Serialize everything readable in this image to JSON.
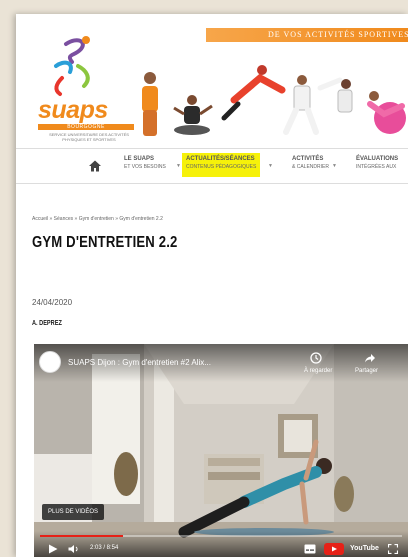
{
  "header": {
    "banner_text": "DE VOS ACTIVITÉS SPORTIVES",
    "logo_word": "suaps",
    "logo_sub": "BOURGOGNE",
    "logo_tagline": "SERVICE UNIVERSITAIRE DES ACTIVITÉS PHYSIQUES ET SPORTIVES"
  },
  "nav": {
    "items": [
      {
        "line1": "LE SUAPS",
        "line2": "ET VOS BESOINS",
        "active": false
      },
      {
        "line1": "ACTUALITÉS/SÉANCES",
        "line2": "CONTENUS PÉDAGOGIQUES",
        "active": true
      },
      {
        "line1": "ACTIVITÉS",
        "line2": "& CALENDRIER",
        "active": false
      },
      {
        "line1": "ÉVALUATIONS",
        "line2": "INTÉGRÉES AUX",
        "active": false
      }
    ]
  },
  "article": {
    "breadcrumb": "Accueil » Séances » Gym d'entretien » Gym d'entretien 2.2",
    "title": "GYM D'ENTRETIEN 2.2",
    "date": "24/04/2020",
    "author": "A. DEPREZ"
  },
  "video": {
    "title": "SUAPS Dijon : Gym d'entretien #2 Alix...",
    "watch_later": "À regarder",
    "share": "Partager",
    "more_videos": "PLUS DE VIDÉOS",
    "time": "2:03 / 8:54",
    "progress": 0.23,
    "youtube_label": "YouTube"
  },
  "colors": {
    "brand_orange": "#f08a1c",
    "nav_highlight": "#f6f10a",
    "progress_red": "#e62117"
  }
}
